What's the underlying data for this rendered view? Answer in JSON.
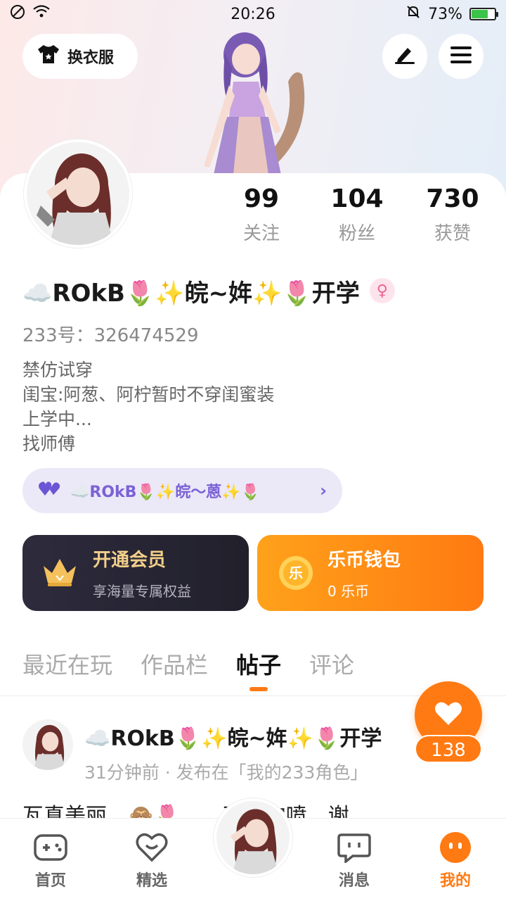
{
  "status_bar": {
    "time": "20:26",
    "battery": "73%",
    "battery_fraction": 0.73
  },
  "header": {
    "dress_up_label": "换衣服"
  },
  "stats": [
    {
      "value": "99",
      "label": "关注"
    },
    {
      "value": "104",
      "label": "粉丝"
    },
    {
      "value": "730",
      "label": "获赞"
    }
  ],
  "profile": {
    "nickname": "☁️ROkB🌷✨皖~姩✨🌷开学",
    "gender_symbol": "♀",
    "uid": "233号：326474529",
    "bio": [
      "禁仿试穿",
      "闺宝:阿葱、阿柠暂时不穿闺蜜装",
      "上学中...",
      "找师傅"
    ],
    "bestie": "☁️ROkB🌷✨皖～蒽✨🌷"
  },
  "promos": {
    "vip": {
      "title": "开通会员",
      "subtitle": "享海量专属权益"
    },
    "wallet": {
      "title": "乐币钱包",
      "subtitle": "0 乐币",
      "coin_glyph": "乐"
    }
  },
  "tabs": [
    {
      "label": "最近在玩",
      "active": false
    },
    {
      "label": "作品栏",
      "active": false
    },
    {
      "label": "帖子",
      "active": true
    },
    {
      "label": "评论",
      "active": false
    }
  ],
  "post": {
    "author": "☁️ROkB🌷✨皖~姩✨🌷开学",
    "meta": "31分钟前 · 发布在「我的233角色」",
    "text": "瓦真美丽　🙈🌷　　不喜勿喷　谢"
  },
  "like": {
    "count": "138"
  },
  "nav": [
    {
      "label": "首页"
    },
    {
      "label": "精选"
    },
    {
      "label": "消息"
    },
    {
      "label": "我的"
    }
  ],
  "colors": {
    "accent": "#ff7a12",
    "vip_gold": "#f3d08a",
    "bestie_purple": "#7a62d6"
  }
}
